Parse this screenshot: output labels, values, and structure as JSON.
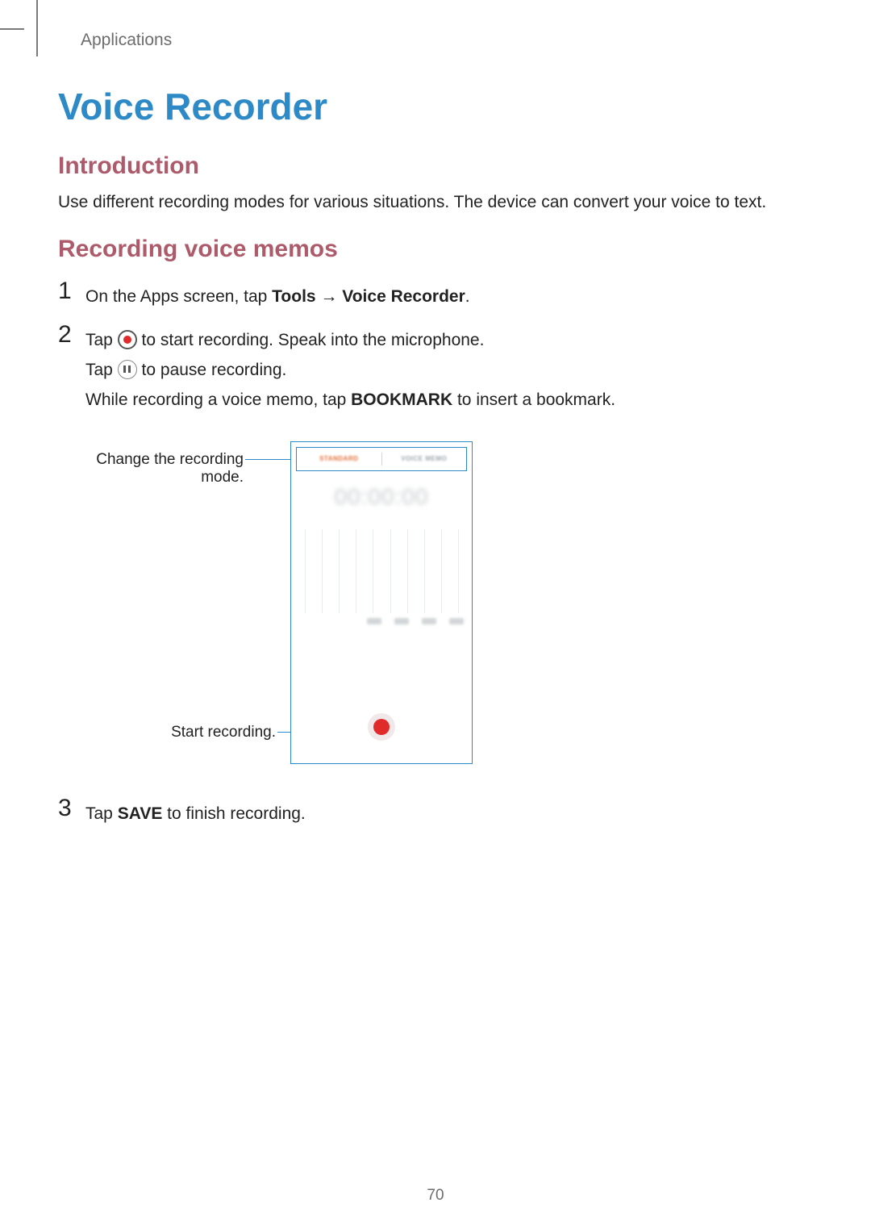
{
  "breadcrumb": "Applications",
  "page_number": "70",
  "title": "Voice Recorder",
  "section_intro": "Introduction",
  "intro_body": "Use different recording modes for various situations. The device can convert your voice to text.",
  "section_record": "Recording voice memos",
  "steps": {
    "s1_num": "1",
    "s1_pre": "On the Apps screen, tap ",
    "s1_b_tools": "Tools",
    "s1_arrow": " → ",
    "s1_b_vr": "Voice Recorder",
    "s1_post": ".",
    "s2_num": "2",
    "s2_l1_pre": "Tap ",
    "s2_l1_post": " to start recording. Speak into the microphone.",
    "s2_l2_pre": "Tap ",
    "s2_l2_post": " to pause recording.",
    "s2_l3_pre": "While recording a voice memo, tap ",
    "s2_l3_b": "BOOKMARK",
    "s2_l3_post": " to insert a bookmark.",
    "s3_num": "3",
    "s3_pre": "Tap ",
    "s3_b": "SAVE",
    "s3_post": " to finish recording."
  },
  "figure": {
    "callout_mode": "Change the recording mode.",
    "callout_start": "Start recording.",
    "tab_standard": "STANDARD",
    "tab_voice_memo": "VOICE MEMO",
    "timer": "00:00:00"
  }
}
